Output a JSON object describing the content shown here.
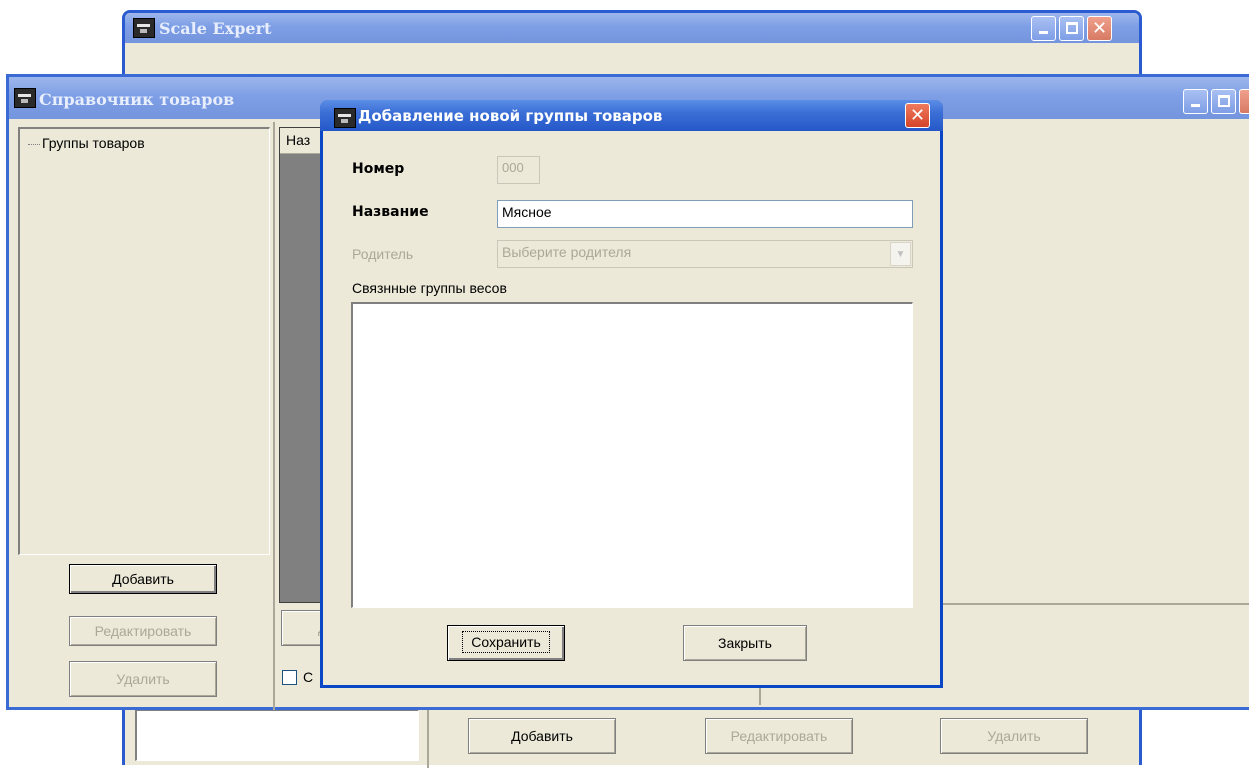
{
  "scale_window": {
    "title": "Scale Expert",
    "buttons": {
      "add": "Добавить",
      "edit": "Редактировать",
      "delete": "Удалить"
    }
  },
  "catalog_window": {
    "title": "Справочник товаров",
    "tree": {
      "root_label": "Группы товаров"
    },
    "left_buttons": {
      "add": "Добавить",
      "edit": "Редактировать",
      "delete": "Удалить"
    },
    "column_header_partial": "Наз",
    "partial_button": "Д",
    "partial_checkbox_label": "С"
  },
  "dialog": {
    "title": "Добавление новой группы товаров",
    "number": {
      "label": "Номер",
      "value": "000"
    },
    "name": {
      "label": "Название",
      "value": "Мясное"
    },
    "parent": {
      "label": "Родитель",
      "placeholder": "Выберите родителя"
    },
    "linked_groups_label": "Связнные группы весов",
    "save_button": "Сохранить",
    "close_button": "Закрыть"
  },
  "colors": {
    "title_active": "#2458c8",
    "title_inactive": "#7e9fe6",
    "window_face": "#ece9d8",
    "close_red": "#e0533d",
    "dark_panel": "#808080"
  },
  "icons": [
    "app-scales-icon",
    "minimize-icon",
    "maximize-icon",
    "close-icon",
    "dropdown-arrow-icon",
    "tree-dots-icon"
  ]
}
